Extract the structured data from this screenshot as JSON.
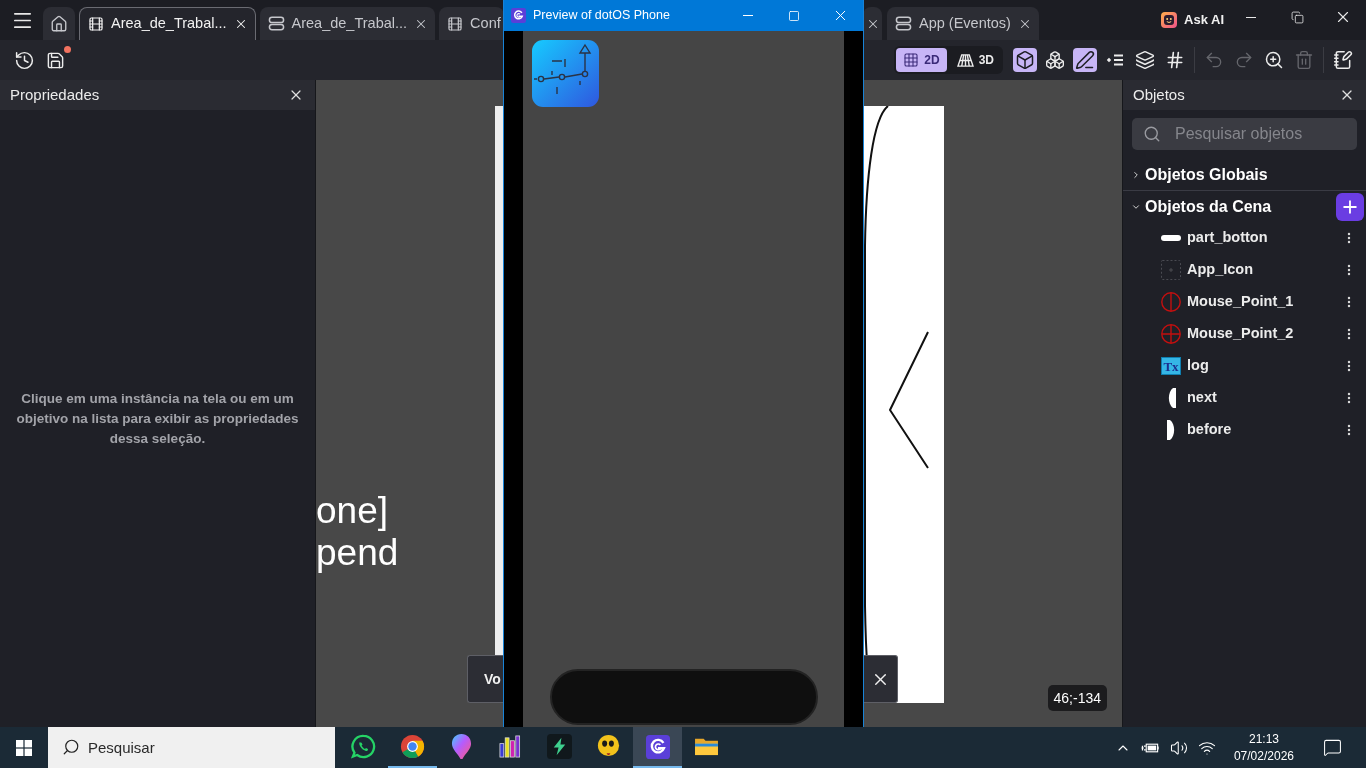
{
  "editor": {
    "tabs": [
      {
        "kind": "home",
        "selected": false,
        "closable": false
      },
      {
        "kind": "scene",
        "label": "Area_de_Trabal...",
        "selected": true,
        "closable": true
      },
      {
        "kind": "events",
        "label": "Area_de_Trabal...",
        "selected": false,
        "closable": true
      },
      {
        "kind": "scene",
        "label": "Conf",
        "selected": false,
        "closable": false
      },
      {
        "kind": "covered",
        "selected": false,
        "closable": true
      },
      {
        "kind": "events",
        "label": "App (Eventos)",
        "selected": false,
        "closable": true
      }
    ],
    "ask_ai": "Ask AI",
    "toolbar": {
      "unsaved_changes": true,
      "view_modes": [
        {
          "kind": "flat",
          "label": "2D",
          "selected": true
        },
        {
          "kind": "perspective",
          "label": "3D",
          "selected": false
        }
      ],
      "tools": [
        {
          "kind": "object",
          "selected": true
        },
        {
          "kind": "instances",
          "selected": false
        },
        {
          "kind": "edit",
          "selected": true
        },
        {
          "kind": "list",
          "selected": false
        },
        {
          "kind": "layers",
          "selected": false
        },
        {
          "kind": "grid",
          "selected": false
        }
      ],
      "history_actions": [
        {
          "kind": "undo",
          "disabled": true
        },
        {
          "kind": "redo",
          "disabled": true
        },
        {
          "kind": "zoom",
          "disabled": false
        },
        {
          "kind": "delete",
          "disabled": true
        }
      ],
      "panel_actions": [
        {
          "kind": "notes",
          "disabled": false
        }
      ]
    },
    "properties_panel": {
      "title": "Propriedades",
      "message": "Clique em uma instância na tela ou em um objetivo na lista para exibir as propriedades dessa seleção."
    },
    "canvas": {
      "scene_text": [
        "one]",
        "pend"
      ],
      "notification": {
        "text": "Vo"
      },
      "coordinates": "46;-134"
    },
    "objects_panel": {
      "title": "Objetos",
      "search": {
        "placeholder": "Pesquisar objetos"
      },
      "groups": [
        {
          "label": "Objetos Globais",
          "expanded": false,
          "add_button": false
        },
        {
          "label": "Objetos da Cena",
          "expanded": true,
          "add_button": true,
          "items": [
            {
              "name": "part_botton",
              "kind": "bar"
            },
            {
              "name": "App_Icon",
              "kind": "placeholder"
            },
            {
              "name": "Mouse_Point_1",
              "kind": "target_split"
            },
            {
              "name": "Mouse_Point_2",
              "kind": "target_cross"
            },
            {
              "name": "log",
              "kind": "text",
              "icon_text": "Tx"
            },
            {
              "name": "next",
              "kind": "curve_left"
            },
            {
              "name": "before",
              "kind": "curve_right"
            }
          ]
        }
      ]
    }
  },
  "preview_window": {
    "title": "Preview of dotOS Phone"
  },
  "taskbar": {
    "search": {
      "placeholder": "Pesquisar"
    },
    "apps": [
      {
        "kind": "chat",
        "running": false,
        "selected": false
      },
      {
        "kind": "browser",
        "running": true,
        "selected": false
      },
      {
        "kind": "balloon",
        "running": false,
        "selected": false
      },
      {
        "kind": "charts",
        "running": false,
        "selected": false
      },
      {
        "kind": "bolt",
        "running": false,
        "selected": false
      },
      {
        "kind": "face",
        "running": false,
        "selected": false
      },
      {
        "kind": "engine",
        "running": true,
        "selected": true
      },
      {
        "kind": "folder",
        "running": false,
        "selected": false
      }
    ],
    "clock": {
      "time": "21:13",
      "date": "07/02/2026"
    }
  }
}
